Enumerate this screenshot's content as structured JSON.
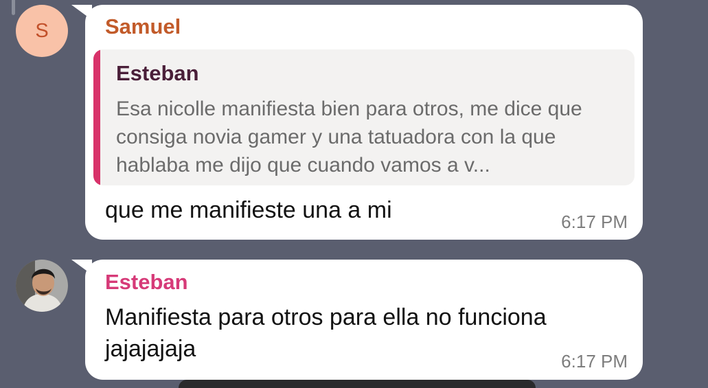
{
  "messages": [
    {
      "sender": "Samuel",
      "avatar_initial": "S",
      "reply": {
        "author": "Esteban",
        "text": "Esa nicolle manifiesta bien para otros, me dice que consiga novia gamer y una tatuadora con la que hablaba me dijo que cuando vamos a v..."
      },
      "text": "que me manifieste una a mi",
      "time": "6:17 PM"
    },
    {
      "sender": "Esteban",
      "avatar": "profile-photo",
      "text": "Manifiesta para otros para ella no funciona jajajajaja",
      "time": "6:17 PM"
    }
  ],
  "colors": {
    "background": "#5a5e6f",
    "samuel_name": "#c25b2a",
    "esteban_name": "#d63a78",
    "quote_bar": "#d8326a"
  }
}
